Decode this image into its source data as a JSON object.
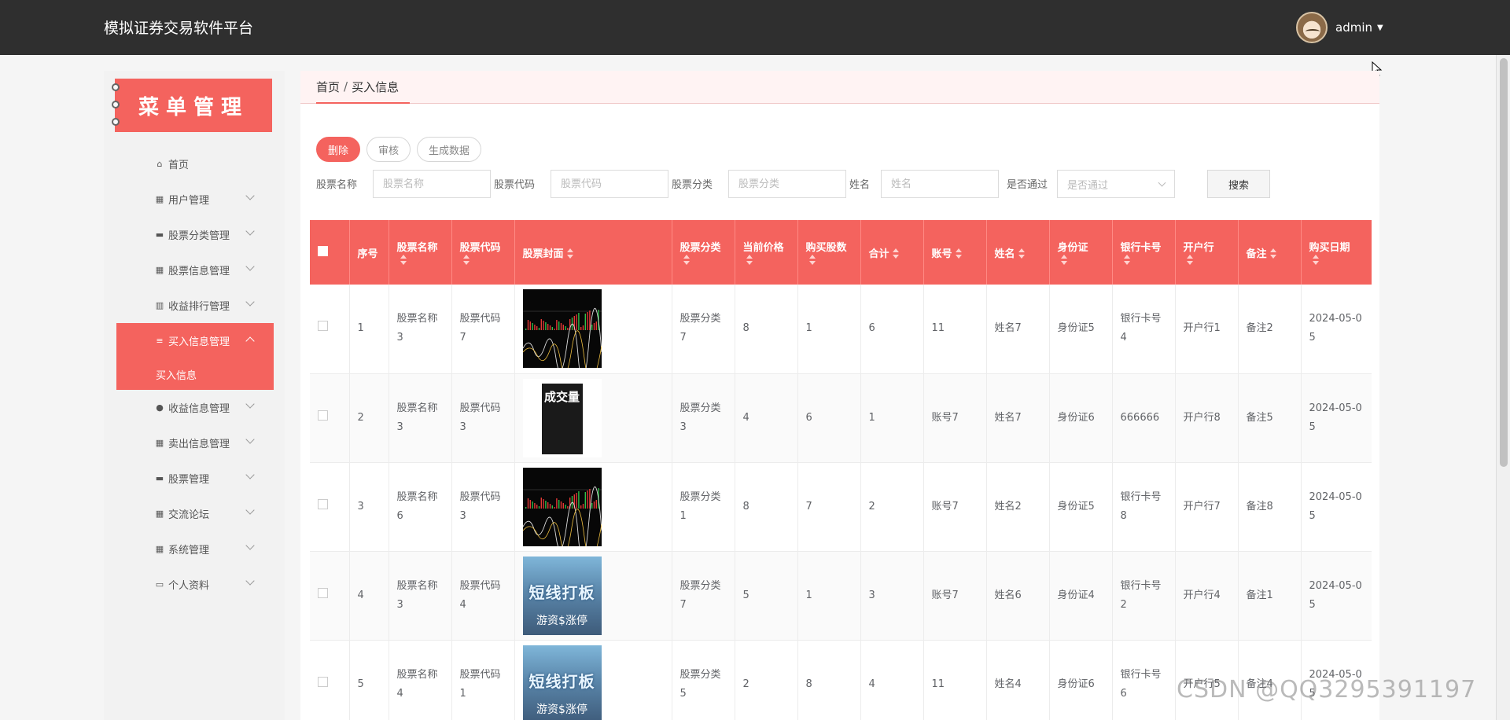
{
  "header": {
    "title": "模拟证券交易软件平台",
    "user": "admin"
  },
  "sidebar": {
    "title": "菜单管理",
    "items": [
      {
        "label": "首页",
        "icon": "home-icon",
        "glyph": "⌂"
      },
      {
        "label": "用户管理",
        "icon": "grid-icon",
        "glyph": "▦"
      },
      {
        "label": "股票分类管理",
        "icon": "folder-icon",
        "glyph": "▬"
      },
      {
        "label": "股票信息管理",
        "icon": "grid-icon",
        "glyph": "▦"
      },
      {
        "label": "收益排行管理",
        "icon": "bar-chart-icon",
        "glyph": "▥"
      },
      {
        "label": "买入信息管理",
        "icon": "sliders-icon",
        "glyph": "≡"
      },
      {
        "label": "收益信息管理",
        "icon": "location-icon",
        "glyph": "●"
      },
      {
        "label": "卖出信息管理",
        "icon": "grid-icon",
        "glyph": "▦"
      },
      {
        "label": "股票管理",
        "icon": "message-icon",
        "glyph": "▬"
      },
      {
        "label": "交流论坛",
        "icon": "grid-icon",
        "glyph": "▦"
      },
      {
        "label": "系统管理",
        "icon": "grid-icon",
        "glyph": "▦"
      },
      {
        "label": "个人资料",
        "icon": "card-icon",
        "glyph": "▭"
      }
    ],
    "active_sub": "买入信息"
  },
  "breadcrumb": {
    "home": "首页",
    "sep": "/",
    "current": "买入信息"
  },
  "toolbar": {
    "delete": "删除",
    "audit": "审核",
    "generate": "生成数据",
    "search": "搜索"
  },
  "filters": [
    {
      "label": "股票名称",
      "placeholder": "股票名称"
    },
    {
      "label": "股票代码",
      "placeholder": "股票代码"
    },
    {
      "label": "股票分类",
      "placeholder": "股票分类"
    },
    {
      "label": "姓名",
      "placeholder": "姓名"
    },
    {
      "label": "是否通过",
      "placeholder": "是否通过"
    }
  ],
  "table": {
    "headers": [
      {
        "label": "序号",
        "sort": false
      },
      {
        "label": "股票名称",
        "sort": true
      },
      {
        "label": "股票代码",
        "sort": true
      },
      {
        "label": "股票封面",
        "sort": true
      },
      {
        "label": "股票分类",
        "sort": true
      },
      {
        "label": "当前价格",
        "sort": true
      },
      {
        "label": "购买股数",
        "sort": true
      },
      {
        "label": "合计",
        "sort": true
      },
      {
        "label": "账号",
        "sort": true
      },
      {
        "label": "姓名",
        "sort": true
      },
      {
        "label": "身份证",
        "sort": true
      },
      {
        "label": "银行卡号",
        "sort": true
      },
      {
        "label": "开户行",
        "sort": true
      },
      {
        "label": "备注",
        "sort": true
      },
      {
        "label": "购买日期",
        "sort": true
      }
    ],
    "rows": [
      {
        "id": "1",
        "name": "股票名称3",
        "code": "股票代码7",
        "cover": "chart",
        "category": "股票分类7",
        "price": "8",
        "shares": "1",
        "total": "6",
        "account": "11",
        "person": "姓名7",
        "idcard": "身份证5",
        "bank": "银行卡号4",
        "branch": "开户行1",
        "note": "备注2",
        "date": "2024-05-05"
      },
      {
        "id": "2",
        "name": "股票名称3",
        "code": "股票代码3",
        "cover": "book",
        "category": "股票分类3",
        "price": "4",
        "shares": "6",
        "total": "1",
        "account": "账号7",
        "person": "姓名7",
        "idcard": "身份证6",
        "bank": "666666",
        "branch": "开户行8",
        "note": "备注5",
        "date": "2024-05-05"
      },
      {
        "id": "3",
        "name": "股票名称6",
        "code": "股票代码3",
        "cover": "chart",
        "category": "股票分类1",
        "price": "8",
        "shares": "7",
        "total": "2",
        "account": "账号7",
        "person": "姓名2",
        "idcard": "身份证5",
        "bank": "银行卡号8",
        "branch": "开户行7",
        "note": "备注8",
        "date": "2024-05-05"
      },
      {
        "id": "4",
        "name": "股票名称3",
        "code": "股票代码4",
        "cover": "poster",
        "category": "股票分类7",
        "price": "5",
        "shares": "1",
        "total": "3",
        "account": "账号7",
        "person": "姓名6",
        "idcard": "身份证4",
        "bank": "银行卡号2",
        "branch": "开户行4",
        "note": "备注1",
        "date": "2024-05-05"
      },
      {
        "id": "5",
        "name": "股票名称4",
        "code": "股票代码1",
        "cover": "poster",
        "category": "股票分类5",
        "price": "2",
        "shares": "8",
        "total": "4",
        "account": "11",
        "person": "姓名4",
        "idcard": "身份证6",
        "bank": "银行卡号6",
        "branch": "开户行5",
        "note": "备注4",
        "date": "2024-05-05"
      }
    ]
  },
  "covers": {
    "book_title": "成交量",
    "poster_title": "短线打板",
    "poster_sub": "游资$涨停"
  },
  "watermark": "CSDN @QQ3295391197",
  "colors": {
    "accent": "#f4635e",
    "topbar": "#2f2f2f"
  }
}
